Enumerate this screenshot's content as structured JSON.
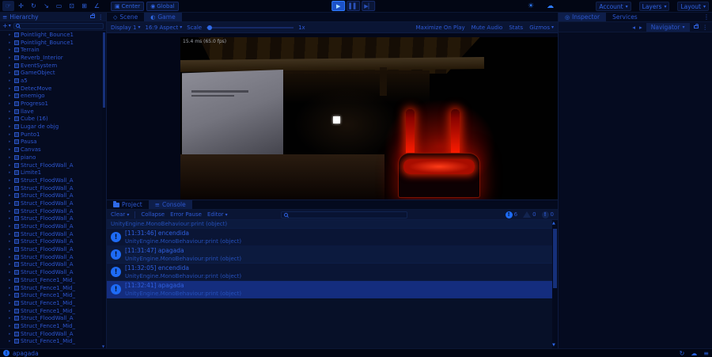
{
  "toolbar": {
    "tools": [
      {
        "name": "hand-tool-icon",
        "glyph": "☞"
      },
      {
        "name": "move-tool-icon",
        "glyph": "✛"
      },
      {
        "name": "rotate-tool-icon",
        "glyph": "↻"
      },
      {
        "name": "scale-tool-icon",
        "glyph": "↘"
      },
      {
        "name": "rect-tool-icon",
        "glyph": "▭"
      },
      {
        "name": "transform-tool-icon",
        "glyph": "⊡"
      },
      {
        "name": "grid-snap-icon",
        "glyph": "⊞"
      },
      {
        "name": "increment-snap-icon",
        "glyph": "∠"
      }
    ],
    "pivot_button": "Center",
    "space_button": "Global",
    "play_glyph": "▶",
    "pause_glyph": "▌▌",
    "step_glyph": "▶▏",
    "account_button": "Account",
    "layers_button": "Layers",
    "layout_button": "Layout"
  },
  "hierarchy": {
    "title": "Hierarchy",
    "create_label": "+",
    "items": [
      "Pointlight_Bounce1",
      "Pointlight_Bounce1",
      "Terrain",
      "Reverb_Interior",
      "EventSystem",
      "GameObject",
      "a5",
      "DetecMove",
      "enemigo",
      "Progreso1",
      "llave",
      "Cube (16)",
      "Lugar de objg",
      "Punto1",
      "Pausa",
      "Canvas",
      "piano",
      "Struct_FloodWall_A",
      "Limite1",
      "Struct_FloodWall_A",
      "Struct_FloodWall_A",
      "Struct_FloodWall_A",
      "Struct_FloodWall_A",
      "Struct_FloodWall_A",
      "Struct_FloodWall_A",
      "Struct_FloodWall_A",
      "Struct_FloodWall_A",
      "Struct_FloodWall_A",
      "Struct_FloodWall_A",
      "Struct_FloodWall_A",
      "Struct_FloodWall_A",
      "Struct_FloodWall_A",
      "Struct_Fence1_Mid_",
      "Struct_Fence1_Mid_",
      "Struct_Fence1_Mid_",
      "Struct_Fence1_Mid_",
      "Struct_Fence1_Mid_",
      "Struct_FloodWall_A",
      "Struct_Fence1_Mid_",
      "Struct_FloodWall_A",
      "Struct_Fence1_Mid_"
    ]
  },
  "scene_tabs": {
    "scene": "Scene",
    "game": "Game"
  },
  "game_toolbar": {
    "display": "Display 1",
    "aspect": "16:9 Aspect",
    "scale_label": "Scale",
    "scale_value": "1x",
    "maximize_on_play": "Maximize On Play",
    "mute_audio": "Mute Audio",
    "stats": "Stats",
    "gizmos": "Gizmos"
  },
  "game_view": {
    "fps_text": "15.4 ms (65.0 fps)"
  },
  "console": {
    "project_tab": "Project",
    "console_tab": "Console",
    "clear": "Clear",
    "collapse": "Collapse",
    "error_pause": "Error Pause",
    "editor": "Editor",
    "counts": {
      "info": "6",
      "warning": "0",
      "error": "0"
    },
    "entries": [
      {
        "message": "",
        "detail": "UnityEngine.MonoBehaviour:print (object)",
        "partial": true
      },
      {
        "message": "[11:31:46] encendida",
        "detail": "UnityEngine.MonoBehaviour:print (object)"
      },
      {
        "message": "[11:31:47] apagada",
        "detail": "UnityEngine.MonoBehaviour:print (object)"
      },
      {
        "message": "[11:32:05] encendida",
        "detail": "UnityEngine.MonoBehaviour:print (object)"
      },
      {
        "message": "[11:32:41] apagada",
        "detail": "UnityEngine.MonoBehaviour:print (object)",
        "selected": true
      }
    ]
  },
  "inspector": {
    "inspector_tab": "Inspector",
    "services_tab": "Services",
    "navigator_label": "Navigator"
  },
  "status_bar": {
    "message": "apagada"
  },
  "colors": {
    "accent": "#2f62e0",
    "glow_red": "#ff2000"
  }
}
